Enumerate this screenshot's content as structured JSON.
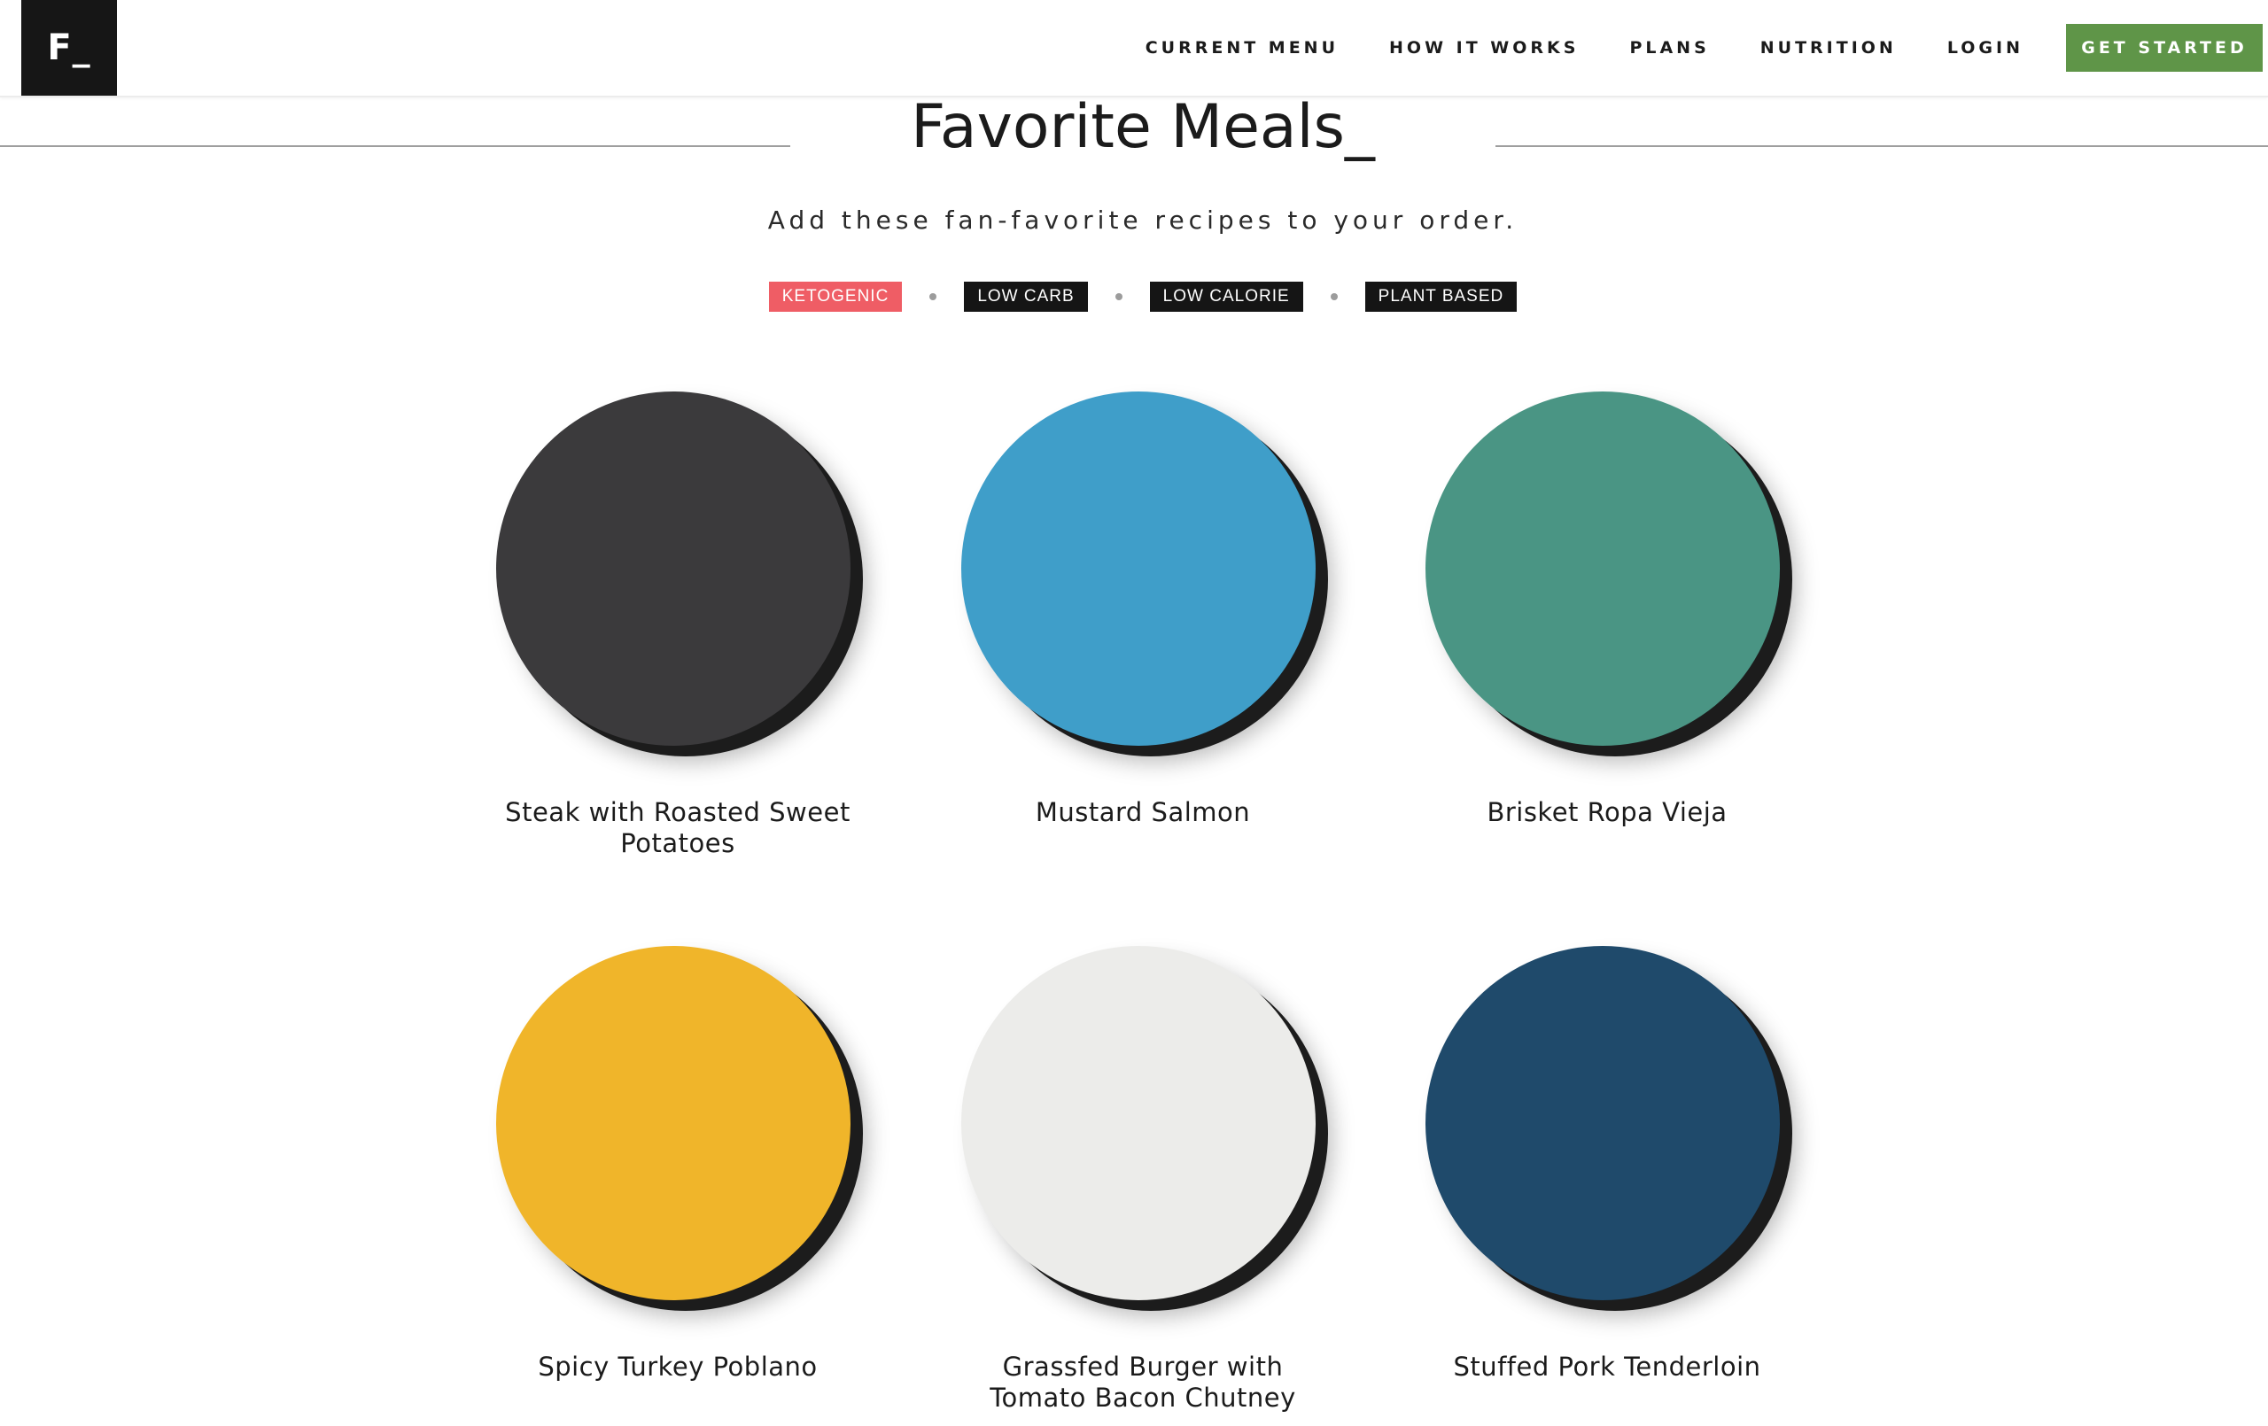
{
  "brand": {
    "logo_text": "F_"
  },
  "nav": {
    "items": [
      "CURRENT MENU",
      "HOW IT WORKS",
      "PLANS",
      "NUTRITION",
      "LOGIN"
    ],
    "cta_label": "GET STARTED",
    "cta_color": "#5f9548"
  },
  "section": {
    "title": "Favorite Meals_",
    "subtitle": "Add these fan-favorite recipes to your order."
  },
  "filters": {
    "items": [
      "KETOGENIC",
      "LOW CARB",
      "LOW CALORIE",
      "PLANT BASED"
    ],
    "active": "KETOGENIC",
    "active_color": "#ef5d65"
  },
  "meals": [
    {
      "name": "Steak with Roasted Sweet Potatoes",
      "plate_color": "#3b3a3c"
    },
    {
      "name": "Mustard Salmon",
      "plate_color": "#3f9ec9"
    },
    {
      "name": "Brisket Ropa Vieja",
      "plate_color": "#4a9584"
    },
    {
      "name": "Spicy Turkey Poblano",
      "plate_color": "#f0b52a"
    },
    {
      "name": "Grassfed Burger with Tomato Bacon Chutney",
      "plate_color": "#ececea"
    },
    {
      "name": "Stuffed Pork Tenderloin",
      "plate_color": "#1f4a6b"
    }
  ]
}
